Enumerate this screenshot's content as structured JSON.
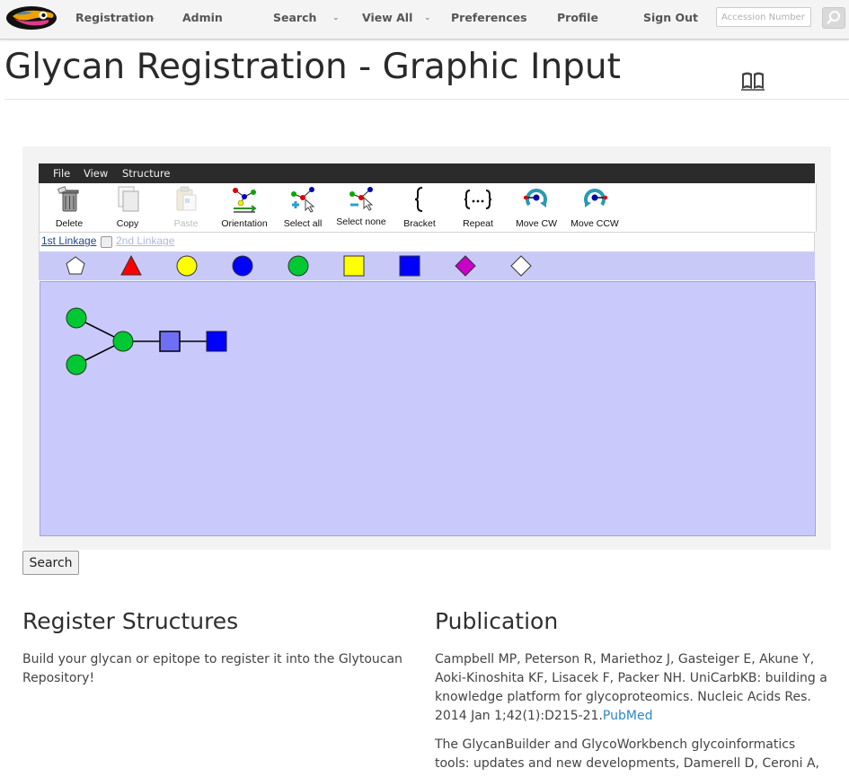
{
  "nav": {
    "logo_alt": "Glytoucan toucan logo",
    "items": [
      {
        "label": "Registration",
        "has_dropdown": true
      },
      {
        "label": "Admin",
        "has_dropdown": false
      },
      {
        "label": "Search",
        "has_dropdown": true
      },
      {
        "label": "View All",
        "has_dropdown": true
      },
      {
        "label": "Preferences",
        "has_dropdown": false
      },
      {
        "label": "Profile",
        "has_dropdown": false
      },
      {
        "label": "Sign Out",
        "has_dropdown": false
      }
    ],
    "search_placeholder": "Accession Number",
    "search_button_icon": "search-icon"
  },
  "page": {
    "title": "Glycan Registration - Graphic Input",
    "help_icon": "book-icon"
  },
  "editor": {
    "menu": [
      "File",
      "View",
      "Structure"
    ],
    "tools": [
      {
        "label": "Delete",
        "icon": "trash-icon",
        "enabled": true
      },
      {
        "label": "Copy",
        "icon": "copy-icon",
        "enabled": true
      },
      {
        "label": "Paste",
        "icon": "paste-icon",
        "enabled": false
      },
      {
        "label": "Orientation",
        "icon": "orientation-icon",
        "enabled": true
      },
      {
        "label": "Select all",
        "icon": "select-all-icon",
        "enabled": true
      },
      {
        "label": "Select none",
        "icon": "select-none-icon",
        "enabled": true
      },
      {
        "label": "Bracket",
        "icon": "bracket-icon",
        "enabled": true
      },
      {
        "label": "Repeat",
        "icon": "repeat-icon",
        "enabled": true
      },
      {
        "label": "Move CW",
        "icon": "rotate-cw-icon",
        "enabled": true
      },
      {
        "label": "Move CCW",
        "icon": "rotate-ccw-icon",
        "enabled": true
      }
    ],
    "linkage": {
      "first": "1st Linkage",
      "second": "2nd Linkage",
      "second_checked": false
    },
    "palette": [
      {
        "shape": "pentagon",
        "color": "#ffffff"
      },
      {
        "shape": "triangle",
        "color": "#ff0000"
      },
      {
        "shape": "circle",
        "color": "#ffff00"
      },
      {
        "shape": "circle",
        "color": "#0000ff"
      },
      {
        "shape": "circle",
        "color": "#00c832"
      },
      {
        "shape": "square",
        "color": "#ffff00"
      },
      {
        "shape": "square",
        "color": "#0000ff"
      },
      {
        "shape": "diamond",
        "color": "#c800c8"
      },
      {
        "shape": "diamond",
        "color": "#ffffff"
      }
    ],
    "canvas_background": "#c9c9fb",
    "structure": {
      "residues": [
        {
          "id": "r1",
          "shape": "circle",
          "color": "#00c832"
        },
        {
          "id": "r2",
          "shape": "circle",
          "color": "#00c832"
        },
        {
          "id": "r3",
          "shape": "circle",
          "color": "#00c832"
        },
        {
          "id": "r4",
          "shape": "square",
          "color": "#6f6ff5",
          "selected": true
        },
        {
          "id": "r5",
          "shape": "square",
          "color": "#0000ff"
        }
      ],
      "bonds": [
        [
          "r1",
          "r3"
        ],
        [
          "r2",
          "r3"
        ],
        [
          "r3",
          "r4"
        ],
        [
          "r4",
          "r5"
        ]
      ]
    }
  },
  "search_button": "Search",
  "register": {
    "heading": "Register Structures",
    "text": "Build your glycan or epitope to register it into the Glytoucan Repository!"
  },
  "publication": {
    "heading": "Publication",
    "citation": "Campbell MP, Peterson R, Mariethoz J, Gasteiger E, Akune Y, Aoki-Kinoshita KF, Lisacek F, Packer NH. UniCarbKB: building a knowledge platform for glycoproteomics. Nucleic Acids Res. 2014 Jan 1;42(1):D215-21.",
    "link_text": "PubMed",
    "citation2": "The GlycanBuilder and GlycoWorkbench glycoinformatics tools: updates and new developments, Damerell D, Ceroni A,"
  }
}
